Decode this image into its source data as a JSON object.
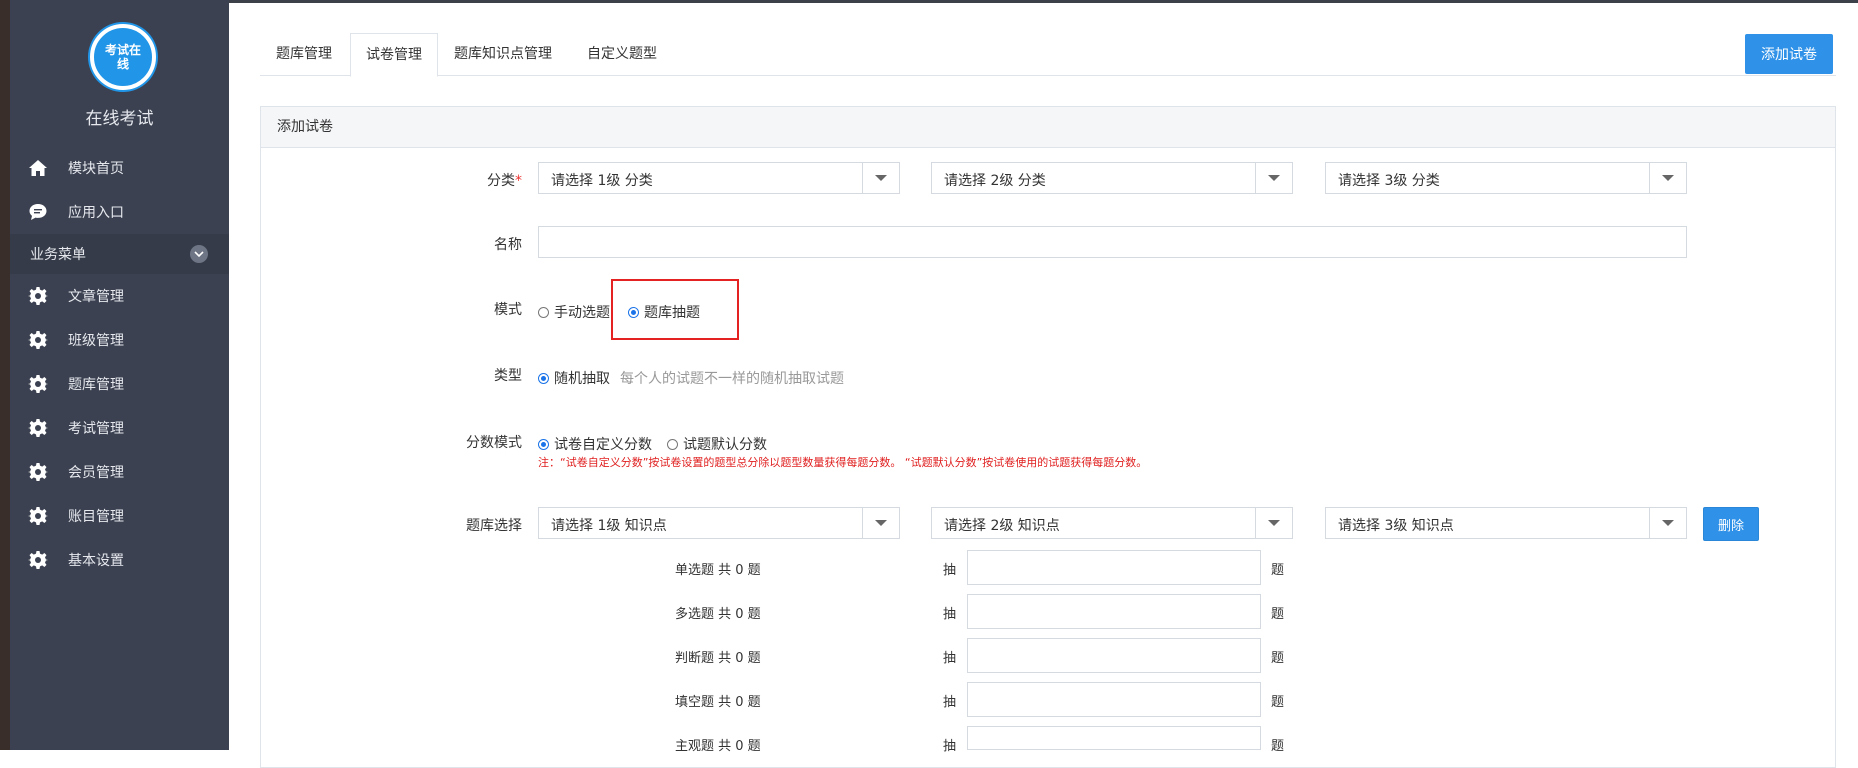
{
  "app": {
    "logo_text": "考试在线",
    "title": "在线考试"
  },
  "sidebar": {
    "top_items": [
      {
        "label": "模块首页",
        "icon": "home-icon"
      },
      {
        "label": "应用入口",
        "icon": "chat-icon"
      }
    ],
    "section": {
      "label": "业务菜单",
      "icon": "chevron-down-icon"
    },
    "items": [
      {
        "label": "文章管理",
        "icon": "gear-icon"
      },
      {
        "label": "班级管理",
        "icon": "gear-icon"
      },
      {
        "label": "题库管理",
        "icon": "gear-icon"
      },
      {
        "label": "考试管理",
        "icon": "gear-icon"
      },
      {
        "label": "会员管理",
        "icon": "gear-icon"
      },
      {
        "label": "账目管理",
        "icon": "gear-icon"
      },
      {
        "label": "基本设置",
        "icon": "gear-icon"
      }
    ]
  },
  "tabs": [
    {
      "label": "题库管理",
      "active": false
    },
    {
      "label": "试卷管理",
      "active": true
    },
    {
      "label": "题库知识点管理",
      "active": false
    },
    {
      "label": "自定义题型",
      "active": false
    }
  ],
  "toolbar": {
    "add_paper": "添加试卷"
  },
  "panel": {
    "title": "添加试卷"
  },
  "form": {
    "category": {
      "label": "分类",
      "required_mark": "*",
      "selects": [
        "请选择 1级 分类",
        "请选择 2级 分类",
        "请选择 3级 分类"
      ]
    },
    "name": {
      "label": "名称",
      "value": ""
    },
    "mode": {
      "label": "模式",
      "options": [
        "手动选题",
        "题库抽题"
      ],
      "selected": "题库抽题"
    },
    "type": {
      "label": "类型",
      "option": "随机抽取",
      "hint": "每个人的试题不一样的随机抽取试题"
    },
    "score_mode": {
      "label": "分数模式",
      "options": [
        "试卷自定义分数",
        "试题默认分数"
      ],
      "selected": "试卷自定义分数",
      "note": "注：“试卷自定义分数”按试卷设置的题型总分除以题型数量获得每题分数。 “试题默认分数”按试卷使用的试题获得每题分数。"
    },
    "bank_select": {
      "label": "题库选择",
      "selects": [
        "请选择 1级 知识点",
        "请选择 2级 知识点",
        "请选择 3级 知识点"
      ],
      "delete": "删除"
    },
    "question_rows": [
      {
        "label": "单选题 共 0 题",
        "draw": "抽",
        "unit": "题",
        "value": ""
      },
      {
        "label": "多选题 共 0 题",
        "draw": "抽",
        "unit": "题",
        "value": ""
      },
      {
        "label": "判断题 共 0 题",
        "draw": "抽",
        "unit": "题",
        "value": ""
      },
      {
        "label": "填空题 共 0 题",
        "draw": "抽",
        "unit": "题",
        "value": ""
      },
      {
        "label": "主观题 共 0 题",
        "draw": "抽",
        "unit": "题",
        "value": ""
      }
    ]
  },
  "colors": {
    "sidebar_bg": "#3b4150",
    "accent": "#2f92e8",
    "highlight_border": "#e52222",
    "note_text": "#e02020"
  }
}
